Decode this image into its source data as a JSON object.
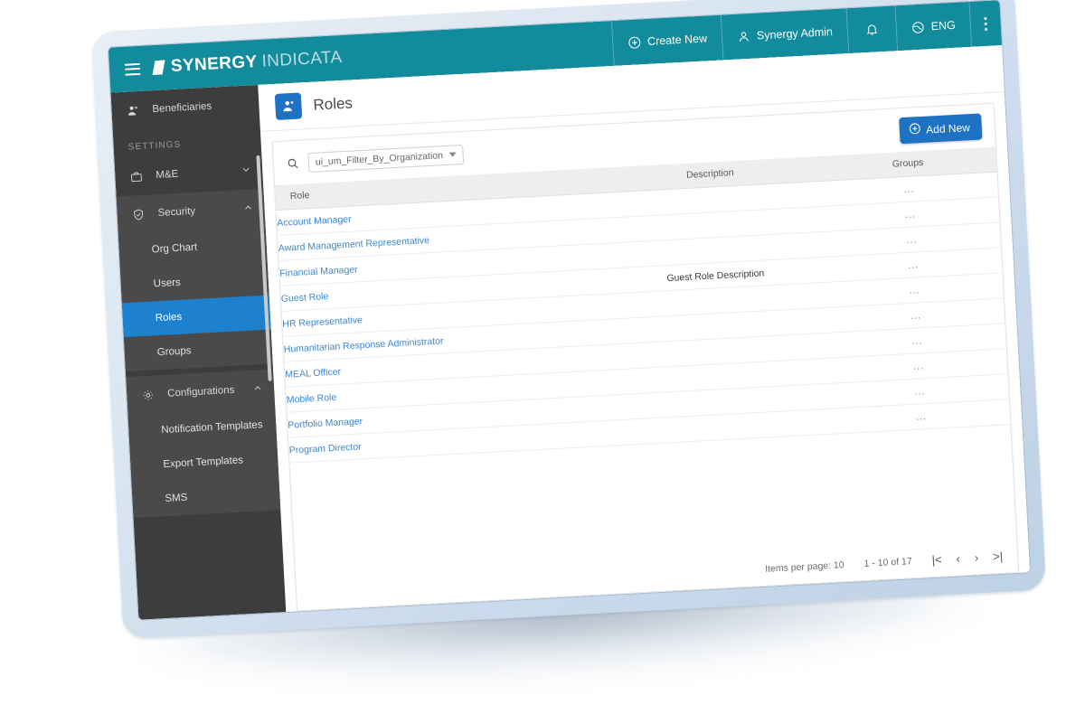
{
  "header": {
    "menu_icon": "hamburger-icon",
    "brand_primary": "SYNERGY",
    "brand_secondary": "INDICATA",
    "actions": [
      {
        "label": "Create New",
        "icon": "plus-circle-icon"
      },
      {
        "label": "Synergy Admin",
        "icon": "user-icon"
      },
      {
        "label": "",
        "icon": "bell-icon"
      },
      {
        "label": "ENG",
        "icon": "globe-icon"
      },
      {
        "label": "",
        "icon": "kebab-menu-icon"
      }
    ]
  },
  "sidebar": {
    "top_item": {
      "label": "Beneficiaries",
      "icon": "beneficiaries-icon"
    },
    "section_label": "SETTINGS",
    "groups": [
      {
        "label": "M&E",
        "icon": "briefcase-icon",
        "expanded": false,
        "chevron": "chevron-down-icon",
        "items": []
      },
      {
        "label": "Security",
        "icon": "shield-check-icon",
        "expanded": true,
        "chevron": "chevron-up-icon",
        "items": [
          {
            "label": "Org Chart",
            "active": false
          },
          {
            "label": "Users",
            "active": false
          },
          {
            "label": "Roles",
            "active": true
          },
          {
            "label": "Groups",
            "active": false
          }
        ]
      },
      {
        "label": "Configurations",
        "icon": "gear-icon",
        "expanded": true,
        "chevron": "chevron-up-icon",
        "items": [
          {
            "label": "Notification Templates",
            "active": false
          },
          {
            "label": "Export Templates",
            "active": false
          },
          {
            "label": "SMS",
            "active": false
          }
        ]
      }
    ]
  },
  "page": {
    "title": "Roles",
    "icon": "roles-user-icon"
  },
  "toolbar": {
    "search_icon": "search-icon",
    "filter_value": "ui_um_Filter_By_Organization",
    "add_label": "Add New",
    "add_icon": "plus-circle-icon"
  },
  "table": {
    "columns": [
      "Role",
      "Description",
      "Groups"
    ],
    "rows": [
      {
        "role": "Account Manager",
        "description": "",
        "groups": "..."
      },
      {
        "role": "Award Management Representative",
        "description": "",
        "groups": "..."
      },
      {
        "role": "Financial Manager",
        "description": "",
        "groups": "..."
      },
      {
        "role": "Guest Role",
        "description": "Guest Role Description",
        "groups": "..."
      },
      {
        "role": "HR Representative",
        "description": "",
        "groups": "..."
      },
      {
        "role": "Humanitarian Response Administrator",
        "description": "",
        "groups": "..."
      },
      {
        "role": "MEAL Officer",
        "description": "",
        "groups": "..."
      },
      {
        "role": "Mobile Role",
        "description": "",
        "groups": "..."
      },
      {
        "role": "Portfolio Manager",
        "description": "",
        "groups": "..."
      },
      {
        "role": "Program Director",
        "description": "",
        "groups": "..."
      }
    ]
  },
  "pagination": {
    "items_per_page_label": "Items per page:",
    "items_per_page_value": "10",
    "range_label": "1 - 10 of 17",
    "first_icon": "|<",
    "prev_icon": "‹",
    "next_icon": "›",
    "last_icon": ">|"
  },
  "colors": {
    "header_teal": "#128c9c",
    "sidebar_dark": "#3d3d3d",
    "sidebar_group": "#4a4a4a",
    "active_blue": "#1d81ce",
    "link_blue": "#3a87d4",
    "button_blue": "#1d72c4",
    "device_frame": "#d6e3ef"
  }
}
